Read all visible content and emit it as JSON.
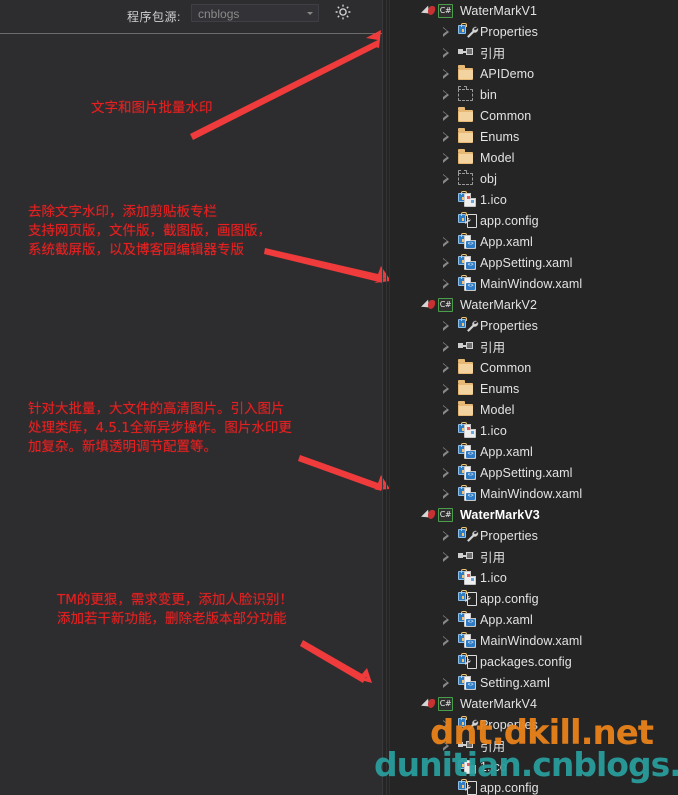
{
  "toolbar": {
    "package_source_label": "程序包源:",
    "package_source_value": "cnblogs",
    "settings_icon": "gear-icon",
    "dropdown_caret": "chevron-down-icon"
  },
  "annotations": [
    {
      "id": "anno-1",
      "text": "文字和图片批量水印",
      "color": "#e62020"
    },
    {
      "id": "anno-2",
      "text": "去除文字水印，添加剪贴板专栏\n支持网页版，文件版，截图版，画图版，\n系统截屏版，以及博客园编辑器专版",
      "color": "#e62020"
    },
    {
      "id": "anno-3",
      "text": "针对大批量，大文件的高清图片。引入图片\n处理类库，4.5.1全新异步操作。图片水印更\n加复杂。新填透明调节配置等。",
      "color": "#e62020"
    },
    {
      "id": "anno-4",
      "text": "TM的更狠，需求变更，添加人脸识别！\n添加若干新功能，删除老版本部分功能",
      "color": "#e62020"
    }
  ],
  "arrows": [
    {
      "name": "arrow-to-watermarkv1",
      "color": "#ef3b3b"
    },
    {
      "name": "arrow-to-watermarkv2",
      "color": "#ef3b3b"
    },
    {
      "name": "arrow-to-watermarkv3",
      "color": "#ef3b3b"
    },
    {
      "name": "arrow-to-watermarkv4",
      "color": "#ef3b3b"
    }
  ],
  "tree": {
    "rows": [
      {
        "label": "WaterMarkV1",
        "depth": 0,
        "icon": "csharp-project-icon",
        "expander": "expanded",
        "bold": false
      },
      {
        "label": "Properties",
        "depth": 1,
        "icon": "wrench-icon",
        "expander": "collapsed",
        "locked": true
      },
      {
        "label": "引用",
        "depth": 1,
        "icon": "references-icon",
        "expander": "collapsed"
      },
      {
        "label": "APIDemo",
        "depth": 1,
        "icon": "folder-icon",
        "expander": "collapsed"
      },
      {
        "label": "bin",
        "depth": 1,
        "icon": "folder-excluded-icon",
        "expander": "collapsed"
      },
      {
        "label": "Common",
        "depth": 1,
        "icon": "folder-icon",
        "expander": "collapsed"
      },
      {
        "label": "Enums",
        "depth": 1,
        "icon": "folder-icon",
        "expander": "collapsed"
      },
      {
        "label": "Model",
        "depth": 1,
        "icon": "folder-icon",
        "expander": "collapsed"
      },
      {
        "label": "obj",
        "depth": 1,
        "icon": "folder-excluded-icon",
        "expander": "collapsed"
      },
      {
        "label": "1.ico",
        "depth": 1,
        "icon": "ico-file-icon",
        "expander": "none",
        "locked": true
      },
      {
        "label": "app.config",
        "depth": 1,
        "icon": "config-file-icon",
        "expander": "none",
        "locked": true
      },
      {
        "label": "App.xaml",
        "depth": 1,
        "icon": "xaml-file-icon",
        "expander": "collapsed",
        "locked": true
      },
      {
        "label": "AppSetting.xaml",
        "depth": 1,
        "icon": "xaml-file-icon",
        "expander": "collapsed",
        "locked": true
      },
      {
        "label": "MainWindow.xaml",
        "depth": 1,
        "icon": "xaml-file-icon",
        "expander": "collapsed",
        "locked": true
      },
      {
        "label": "WaterMarkV2",
        "depth": 0,
        "icon": "csharp-project-icon",
        "expander": "expanded",
        "bold": false
      },
      {
        "label": "Properties",
        "depth": 1,
        "icon": "wrench-icon",
        "expander": "collapsed",
        "locked": true
      },
      {
        "label": "引用",
        "depth": 1,
        "icon": "references-icon",
        "expander": "collapsed"
      },
      {
        "label": "Common",
        "depth": 1,
        "icon": "folder-icon",
        "expander": "collapsed"
      },
      {
        "label": "Enums",
        "depth": 1,
        "icon": "folder-icon",
        "expander": "collapsed"
      },
      {
        "label": "Model",
        "depth": 1,
        "icon": "folder-icon",
        "expander": "collapsed"
      },
      {
        "label": "1.ico",
        "depth": 1,
        "icon": "ico-file-icon",
        "expander": "none",
        "locked": true
      },
      {
        "label": "App.xaml",
        "depth": 1,
        "icon": "xaml-file-icon",
        "expander": "collapsed",
        "locked": true
      },
      {
        "label": "AppSetting.xaml",
        "depth": 1,
        "icon": "xaml-file-icon",
        "expander": "collapsed",
        "locked": true
      },
      {
        "label": "MainWindow.xaml",
        "depth": 1,
        "icon": "xaml-file-icon",
        "expander": "collapsed",
        "locked": true
      },
      {
        "label": "WaterMarkV3",
        "depth": 0,
        "icon": "csharp-project-icon",
        "expander": "expanded",
        "bold": true
      },
      {
        "label": "Properties",
        "depth": 1,
        "icon": "wrench-icon",
        "expander": "collapsed",
        "locked": true
      },
      {
        "label": "引用",
        "depth": 1,
        "icon": "references-icon",
        "expander": "collapsed"
      },
      {
        "label": "1.ico",
        "depth": 1,
        "icon": "ico-file-icon",
        "expander": "none",
        "locked": true
      },
      {
        "label": "app.config",
        "depth": 1,
        "icon": "config-file-icon",
        "expander": "none",
        "locked": true
      },
      {
        "label": "App.xaml",
        "depth": 1,
        "icon": "xaml-file-icon",
        "expander": "collapsed",
        "locked": true
      },
      {
        "label": "MainWindow.xaml",
        "depth": 1,
        "icon": "xaml-file-icon",
        "expander": "collapsed",
        "locked": true
      },
      {
        "label": "packages.config",
        "depth": 1,
        "icon": "config-file-icon",
        "expander": "none",
        "locked": true
      },
      {
        "label": "Setting.xaml",
        "depth": 1,
        "icon": "xaml-file-icon",
        "expander": "collapsed",
        "locked": true
      },
      {
        "label": "WaterMarkV4",
        "depth": 0,
        "icon": "csharp-project-icon",
        "expander": "expanded",
        "bold": false
      },
      {
        "label": "Properties",
        "depth": 1,
        "icon": "wrench-icon",
        "expander": "collapsed",
        "locked": true
      },
      {
        "label": "引用",
        "depth": 1,
        "icon": "references-icon",
        "expander": "collapsed"
      },
      {
        "label": "1.ico",
        "depth": 1,
        "icon": "ico-file-icon",
        "expander": "none",
        "locked": true
      },
      {
        "label": "app.config",
        "depth": 1,
        "icon": "config-file-icon",
        "expander": "none",
        "locked": true
      }
    ]
  },
  "watermarks": {
    "orange_text": "dnt.dkill.net",
    "orange_color": "#e8821a",
    "teal_text": "dunitian.cnblogs.com",
    "teal_color": "#2a9d9d"
  }
}
